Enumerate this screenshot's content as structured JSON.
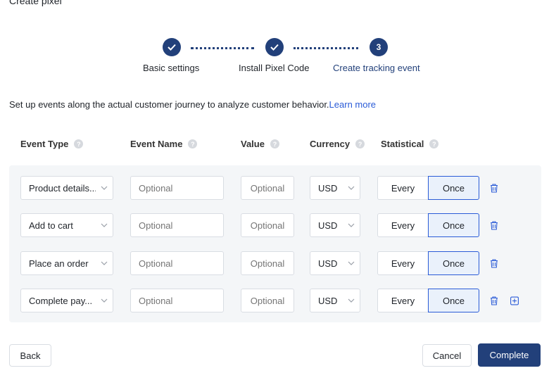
{
  "page": {
    "title": "Create pixel"
  },
  "stepper": {
    "steps": [
      {
        "label": "Basic settings",
        "status": "done",
        "icon": "check-icon"
      },
      {
        "label": "Install Pixel Code",
        "status": "done",
        "icon": "check-icon"
      },
      {
        "label": "Create tracking event",
        "status": "active",
        "number": "3"
      }
    ]
  },
  "description": {
    "text": "Set up events along the actual customer journey to analyze customer behavior.",
    "link": "Learn more"
  },
  "columns": {
    "event_type": "Event Type",
    "event_name": "Event Name",
    "value": "Value",
    "currency": "Currency",
    "statistical": "Statistical",
    "help_glyph": "?"
  },
  "rows": [
    {
      "event_type": "Product details...",
      "event_name_placeholder": "Optional",
      "value_placeholder": "Optional",
      "currency": "USD",
      "stat_every": "Every",
      "stat_once": "Once",
      "selected": "Once"
    },
    {
      "event_type": "Add to cart",
      "event_name_placeholder": "Optional",
      "value_placeholder": "Optional",
      "currency": "USD",
      "stat_every": "Every",
      "stat_once": "Once",
      "selected": "Once"
    },
    {
      "event_type": "Place an order",
      "event_name_placeholder": "Optional",
      "value_placeholder": "Optional",
      "currency": "USD",
      "stat_every": "Every",
      "stat_once": "Once",
      "selected": "Once"
    },
    {
      "event_type": "Complete pay...",
      "event_name_placeholder": "Optional",
      "value_placeholder": "Optional",
      "currency": "USD",
      "stat_every": "Every",
      "stat_once": "Once",
      "selected": "Once"
    }
  ],
  "footer": {
    "back": "Back",
    "cancel": "Cancel",
    "complete": "Complete"
  },
  "colors": {
    "primary": "#22407a",
    "link": "#2a5bd7",
    "panel": "#f4f6f8",
    "selected_bg": "#eaf1fb"
  }
}
